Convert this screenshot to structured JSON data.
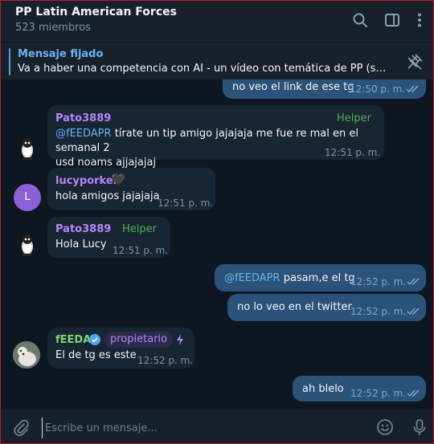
{
  "header": {
    "title": "PP Latin American Forces",
    "subtitle": "523 miembros"
  },
  "pinned": {
    "label": "Mensaje fijado",
    "text": "Va a haber una competencia con AI - un vídeo con temática de PP (sentite lib..."
  },
  "messages": [
    {
      "text": "no veo el link de ese tg",
      "time": "12:50 p. m."
    },
    {
      "sender": "Pato3889",
      "role": "Helper",
      "mention": "@fEEDAPR",
      "text1": " tírate un tip amigo jajajaja me fue re mal en el semanal 2",
      "text2": "usd noams ajjajajaj",
      "time": "12:51 p. m."
    },
    {
      "sender": "lucyporker",
      "emoji": "🖤",
      "avatar_letter": "L",
      "text": "hola amigos jajajaja",
      "time": "12:51 p. m."
    },
    {
      "sender": "Pato3889",
      "role": "Helper",
      "text": "Hola Lucy",
      "time": "12:51 p. m."
    },
    {
      "mention": "@fEEDAPR",
      "text": " pasam,e el tg",
      "time": "12:52 p. m."
    },
    {
      "text": "no lo veo en el twitter",
      "time": "12:52 p. m."
    },
    {
      "sender": "fEEDA",
      "role": "propietario",
      "text": "El de tg es este",
      "time": "12:52 p. m."
    },
    {
      "text": "ah blelo",
      "time": "12:52 p. m."
    }
  ],
  "composer": {
    "placeholder": "Escribe un mensaje..."
  },
  "colors": {
    "background": "#0e1621",
    "panel": "#17212b",
    "incoming": "#182533",
    "outgoing": "#2b5278",
    "accent": "#6cb3f2",
    "pato_name": "#b488f5",
    "lucy_name": "#b488f5",
    "feeda_name": "#7dd872",
    "helper_badge": "#4fae4e",
    "owner_badge": "#b488f5"
  },
  "icons": [
    "search-icon",
    "sidebar-toggle-icon",
    "more-vertical-icon",
    "unpin-icon",
    "attach-icon",
    "emoji-icon",
    "microphone-icon",
    "verified-icon",
    "boost-icon",
    "read-checks-icon"
  ]
}
